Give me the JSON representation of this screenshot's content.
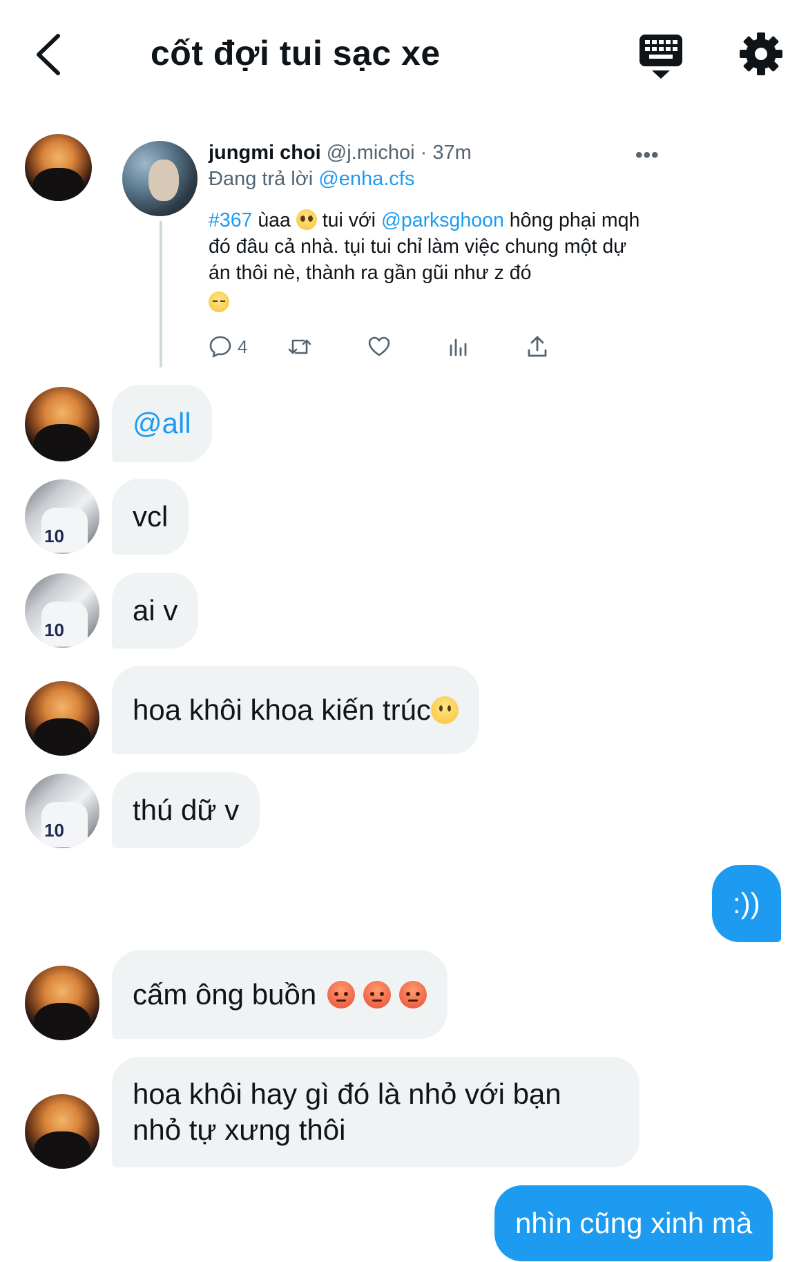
{
  "header": {
    "title": "cốt đợi tui sạc xe",
    "back_icon": "chevron-left-icon",
    "keyboard_icon": "keyboard-icon",
    "settings_icon": "gear-icon"
  },
  "quoted_tweet": {
    "author_name": "jungmi choi",
    "author_handle": "@j.michoi",
    "separator": " · ",
    "time": "37m",
    "reply_prefix": "Đang trả lời ",
    "reply_to": "@enha.cfs",
    "hashtag": "#367",
    "text_part1": " ùaa ",
    "text_part2": "  tui với ",
    "mention": "@parksghoon",
    "text_part3": " hông phại mqh đó đâu cả nhà. tụi tui chỉ làm việc chung một dự án thôi nè, thành ra gần gũi như z đó",
    "reply_count": "4",
    "more_label": "•••"
  },
  "messages": [
    {
      "text": "@all",
      "sender": "sunset"
    },
    {
      "text": "vcl",
      "sender": "niki"
    },
    {
      "text": "ai v",
      "sender": "niki"
    },
    {
      "text": "hoa khôi khoa kiến trúc ",
      "sender": "sunset"
    },
    {
      "text": "thú dữ v",
      "sender": "niki"
    },
    {
      "text": ":))",
      "sender": "me"
    },
    {
      "text": "cấm ông buồn",
      "sender": "sunset"
    },
    {
      "text": "hoa khôi hay gì đó là nhỏ với bạn nhỏ tự xưng thôi",
      "line1": "hoa khôi hay gì đó là nhỏ với bạn",
      "line2": "nhỏ tự xưng thôi",
      "sender": "sunset"
    },
    {
      "text": "nhìn cũng xinh mà",
      "sender": "me"
    }
  ],
  "avatar_label": "10",
  "colors": {
    "accent": "#1d9bf0",
    "bubble_in": "#eff3f4",
    "secondary_text": "#536471"
  }
}
